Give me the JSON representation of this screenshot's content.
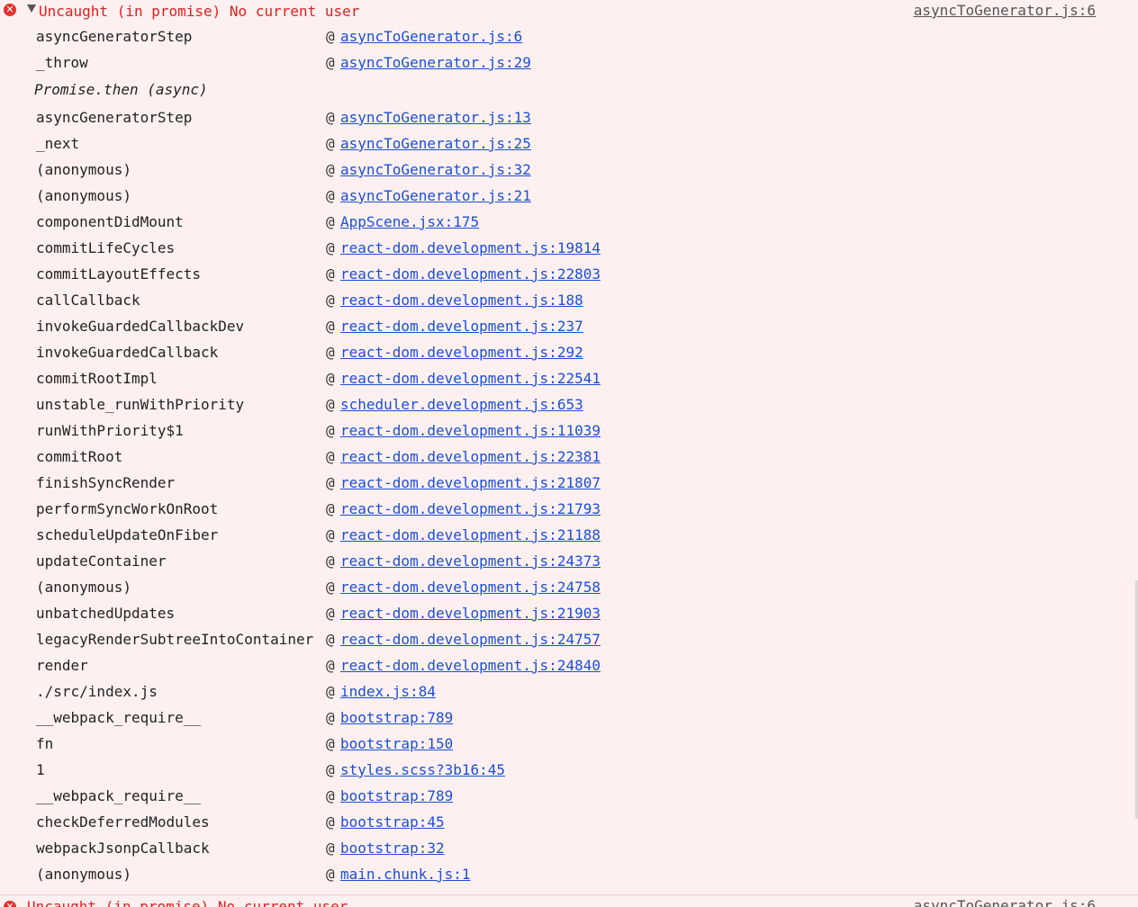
{
  "error": {
    "message": "Uncaught (in promise) No current user",
    "source": "asyncToGenerator.js:6"
  },
  "stack": [
    {
      "fn": "asyncGeneratorStep",
      "link": "asyncToGenerator.js:6"
    },
    {
      "fn": "_throw",
      "link": "asyncToGenerator.js:29"
    },
    {
      "fn": "Promise.then (async)",
      "async": true
    },
    {
      "fn": "asyncGeneratorStep",
      "link": "asyncToGenerator.js:13"
    },
    {
      "fn": "_next",
      "link": "asyncToGenerator.js:25"
    },
    {
      "fn": "(anonymous)",
      "link": "asyncToGenerator.js:32"
    },
    {
      "fn": "(anonymous)",
      "link": "asyncToGenerator.js:21"
    },
    {
      "fn": "componentDidMount",
      "link": "AppScene.jsx:175"
    },
    {
      "fn": "commitLifeCycles",
      "link": "react-dom.development.js:19814"
    },
    {
      "fn": "commitLayoutEffects",
      "link": "react-dom.development.js:22803"
    },
    {
      "fn": "callCallback",
      "link": "react-dom.development.js:188"
    },
    {
      "fn": "invokeGuardedCallbackDev",
      "link": "react-dom.development.js:237"
    },
    {
      "fn": "invokeGuardedCallback",
      "link": "react-dom.development.js:292"
    },
    {
      "fn": "commitRootImpl",
      "link": "react-dom.development.js:22541"
    },
    {
      "fn": "unstable_runWithPriority",
      "link": "scheduler.development.js:653"
    },
    {
      "fn": "runWithPriority$1",
      "link": "react-dom.development.js:11039"
    },
    {
      "fn": "commitRoot",
      "link": "react-dom.development.js:22381"
    },
    {
      "fn": "finishSyncRender",
      "link": "react-dom.development.js:21807"
    },
    {
      "fn": "performSyncWorkOnRoot",
      "link": "react-dom.development.js:21793"
    },
    {
      "fn": "scheduleUpdateOnFiber",
      "link": "react-dom.development.js:21188"
    },
    {
      "fn": "updateContainer",
      "link": "react-dom.development.js:24373"
    },
    {
      "fn": "(anonymous)",
      "link": "react-dom.development.js:24758"
    },
    {
      "fn": "unbatchedUpdates",
      "link": "react-dom.development.js:21903"
    },
    {
      "fn": "legacyRenderSubtreeIntoContainer",
      "link": "react-dom.development.js:24757"
    },
    {
      "fn": "render",
      "link": "react-dom.development.js:24840"
    },
    {
      "fn": "./src/index.js",
      "link": "index.js:84"
    },
    {
      "fn": "__webpack_require__",
      "link": "bootstrap:789"
    },
    {
      "fn": "fn",
      "link": "bootstrap:150"
    },
    {
      "fn": "1",
      "link": "styles.scss?3b16:45"
    },
    {
      "fn": "__webpack_require__",
      "link": "bootstrap:789"
    },
    {
      "fn": "checkDeferredModules",
      "link": "bootstrap:45"
    },
    {
      "fn": "webpackJsonpCallback",
      "link": "bootstrap:32"
    },
    {
      "fn": "(anonymous)",
      "link": "main.chunk.js:1"
    }
  ],
  "at_symbol": "@",
  "icons": {
    "error": "error-circle-icon",
    "toggle": "triangle-down-icon"
  },
  "colors": {
    "background": "#fef0f0",
    "error_text": "#e02020",
    "link": "#1a4fd6",
    "error_icon": "#e0322e"
  }
}
